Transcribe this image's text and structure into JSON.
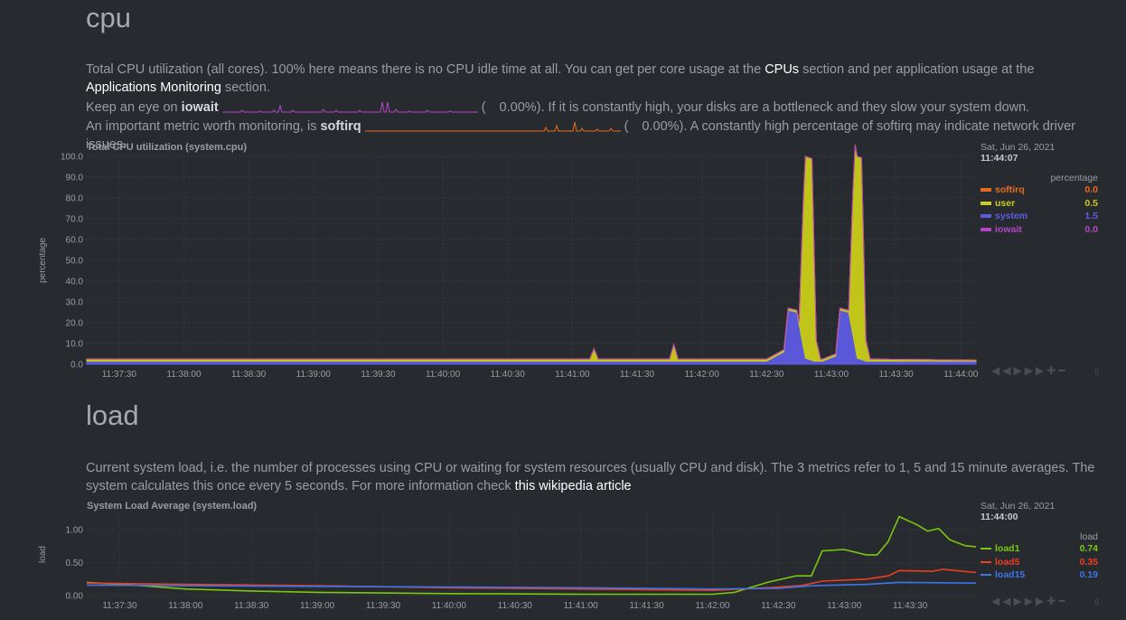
{
  "cpu": {
    "title": "cpu",
    "desc1_pre": "Total CPU utilization (all cores). 100% here means there is no CPU idle time at all. You can get per core usage at the ",
    "desc1_link1": "CPUs",
    "desc1_mid": " section and per application usage at the ",
    "desc1_link2": "Applications Monitoring",
    "desc1_post": " section.",
    "iowait_pre": "Keep an eye on ",
    "iowait_name": "iowait",
    "iowait_paren": "(",
    "iowait_value": "0.00%",
    "iowait_post": "). If it is constantly high, your disks are a bottleneck and they slow your system down.",
    "softirq_pre": "An important metric worth monitoring, is ",
    "softirq_name": "softirq",
    "softirq_paren": "(",
    "softirq_value": "0.00%",
    "softirq_post": "). A constantly high percentage of softirq may indicate network driver issues.",
    "chart_title": "Total CPU utilization (system.cpu)",
    "legend": {
      "date": "Sat, Jun 26, 2021",
      "time": "11:44:07",
      "units": "percentage",
      "items": [
        {
          "name": "softirq",
          "value": "0.0",
          "color": "#e86a1c"
        },
        {
          "name": "user",
          "value": "0.5",
          "color": "#c9cc18"
        },
        {
          "name": "system",
          "value": "1.5",
          "color": "#5d5be2"
        },
        {
          "name": "iowait",
          "value": "0.0",
          "color": "#b446c4"
        }
      ]
    }
  },
  "load": {
    "title": "load",
    "desc_pre": "Current system load, i.e. the number of processes using CPU or waiting for system resources (usually CPU and disk). The 3 metrics refer to 1, 5 and 15 minute averages. The system calculates this once every 5 seconds. For more information check ",
    "desc_link": "this wikipedia article",
    "chart_title": "System Load Average (system.load)",
    "legend": {
      "date": "Sat, Jun 26, 2021",
      "time": "11:44:00",
      "units": "load",
      "items": [
        {
          "name": "load1",
          "value": "0.74",
          "color": "#7ac70c"
        },
        {
          "name": "load5",
          "value": "0.35",
          "color": "#ef3d1f"
        },
        {
          "name": "load15",
          "value": "0.19",
          "color": "#3f74e8"
        }
      ]
    }
  },
  "toolbar": {
    "icons": [
      "rewind-icon",
      "play-icon",
      "fast-forward-icon",
      "zoom-in-icon",
      "zoom-out-icon"
    ],
    "glyphs": "◀◀ ▶ ▶▶ ✚ ━",
    "resize_glyph": "⇳"
  },
  "chart_data": [
    {
      "type": "area",
      "title": "Total CPU utilization (system.cpu)",
      "ylabel": "percentage",
      "ylim": [
        0,
        100
      ],
      "yticks": [
        "0.0",
        "10.0",
        "20.0",
        "30.0",
        "40.0",
        "50.0",
        "60.0",
        "70.0",
        "80.0",
        "90.0",
        "100.0"
      ],
      "xticks": [
        "11:37:30",
        "11:38:00",
        "11:38:30",
        "11:39:00",
        "11:39:30",
        "11:40:00",
        "11:40:30",
        "11:41:00",
        "11:41:30",
        "11:42:00",
        "11:42:30",
        "11:43:00",
        "11:43:30",
        "11:44:00"
      ],
      "xrange": [
        "11:37:15",
        "11:44:07"
      ],
      "series": [
        {
          "name": "system",
          "color": "#5d5be2",
          "points": [
            [
              "11:37:15",
              1.5
            ],
            [
              "11:42:30",
              1.5
            ],
            [
              "11:42:38",
              6
            ],
            [
              "11:42:40",
              26
            ],
            [
              "11:42:44",
              25
            ],
            [
              "11:42:48",
              3
            ],
            [
              "11:42:52",
              1.5
            ],
            [
              "11:42:56",
              1.5
            ],
            [
              "11:43:02",
              4
            ],
            [
              "11:43:04",
              26
            ],
            [
              "11:43:08",
              25
            ],
            [
              "11:43:12",
              3
            ],
            [
              "11:43:16",
              1.5
            ],
            [
              "11:44:07",
              1.5
            ]
          ]
        },
        {
          "name": "user",
          "color": "#c9cc18",
          "points": [
            [
              "11:37:15",
              1
            ],
            [
              "11:41:08",
              1
            ],
            [
              "11:41:10",
              6
            ],
            [
              "11:41:12",
              1
            ],
            [
              "11:41:45",
              1
            ],
            [
              "11:41:47",
              8
            ],
            [
              "11:41:49",
              1
            ],
            [
              "11:42:45",
              1
            ],
            [
              "11:42:47",
              70
            ],
            [
              "11:42:48",
              97
            ],
            [
              "11:42:51",
              97
            ],
            [
              "11:42:53",
              10
            ],
            [
              "11:42:55",
              1
            ],
            [
              "11:43:08",
              1
            ],
            [
              "11:43:10",
              70
            ],
            [
              "11:43:11",
              97
            ],
            [
              "11:43:14",
              97
            ],
            [
              "11:43:16",
              10
            ],
            [
              "11:43:18",
              1
            ],
            [
              "11:44:07",
              0.5
            ]
          ]
        },
        {
          "name": "softirq",
          "color": "#e86a1c",
          "points": [
            [
              "11:37:15",
              0
            ],
            [
              "11:44:07",
              0
            ]
          ]
        },
        {
          "name": "iowait",
          "color": "#b446c4",
          "points": [
            [
              "11:37:15",
              0
            ],
            [
              "11:44:07",
              0
            ]
          ]
        }
      ]
    },
    {
      "type": "line",
      "title": "System Load Average (system.load)",
      "ylabel": "load",
      "ylim": [
        0,
        1.25
      ],
      "yticks": [
        "0.00",
        "0.50",
        "1.00"
      ],
      "xticks": [
        "11:37:30",
        "11:38:00",
        "11:38:30",
        "11:39:00",
        "11:39:30",
        "11:40:00",
        "11:40:30",
        "11:41:00",
        "11:41:30",
        "11:42:00",
        "11:42:30",
        "11:43:00",
        "11:43:30"
      ],
      "xrange": [
        "11:37:15",
        "11:44:00"
      ],
      "series": [
        {
          "name": "load1",
          "color": "#7ac70c",
          "points": [
            [
              "11:37:15",
              0.2
            ],
            [
              "11:37:40",
              0.15
            ],
            [
              "11:38:00",
              0.1
            ],
            [
              "11:38:30",
              0.07
            ],
            [
              "11:39:00",
              0.05
            ],
            [
              "11:40:00",
              0.03
            ],
            [
              "11:41:00",
              0.02
            ],
            [
              "11:42:00",
              0.02
            ],
            [
              "11:42:10",
              0.05
            ],
            [
              "11:42:25",
              0.2
            ],
            [
              "11:42:38",
              0.3
            ],
            [
              "11:42:45",
              0.3
            ],
            [
              "11:42:50",
              0.68
            ],
            [
              "11:43:00",
              0.7
            ],
            [
              "11:43:10",
              0.62
            ],
            [
              "11:43:15",
              0.62
            ],
            [
              "11:43:20",
              0.82
            ],
            [
              "11:43:25",
              1.2
            ],
            [
              "11:43:33",
              1.08
            ],
            [
              "11:43:38",
              0.98
            ],
            [
              "11:43:43",
              1.02
            ],
            [
              "11:43:48",
              0.85
            ],
            [
              "11:43:55",
              0.76
            ],
            [
              "11:44:00",
              0.74
            ]
          ]
        },
        {
          "name": "load5",
          "color": "#ef3d1f",
          "points": [
            [
              "11:37:15",
              0.19
            ],
            [
              "11:38:00",
              0.17
            ],
            [
              "11:39:00",
              0.15
            ],
            [
              "11:40:00",
              0.12
            ],
            [
              "11:41:00",
              0.1
            ],
            [
              "11:42:00",
              0.08
            ],
            [
              "11:42:25",
              0.12
            ],
            [
              "11:42:40",
              0.15
            ],
            [
              "11:42:50",
              0.22
            ],
            [
              "11:43:10",
              0.25
            ],
            [
              "11:43:20",
              0.3
            ],
            [
              "11:43:25",
              0.38
            ],
            [
              "11:43:40",
              0.37
            ],
            [
              "11:43:45",
              0.4
            ],
            [
              "11:44:00",
              0.35
            ]
          ]
        },
        {
          "name": "load15",
          "color": "#3f74e8",
          "points": [
            [
              "11:37:15",
              0.16
            ],
            [
              "11:38:00",
              0.15
            ],
            [
              "11:39:00",
              0.14
            ],
            [
              "11:40:00",
              0.13
            ],
            [
              "11:41:00",
              0.12
            ],
            [
              "11:42:00",
              0.1
            ],
            [
              "11:42:30",
              0.11
            ],
            [
              "11:42:45",
              0.15
            ],
            [
              "11:43:10",
              0.17
            ],
            [
              "11:43:25",
              0.2
            ],
            [
              "11:44:00",
              0.19
            ]
          ]
        }
      ]
    }
  ]
}
